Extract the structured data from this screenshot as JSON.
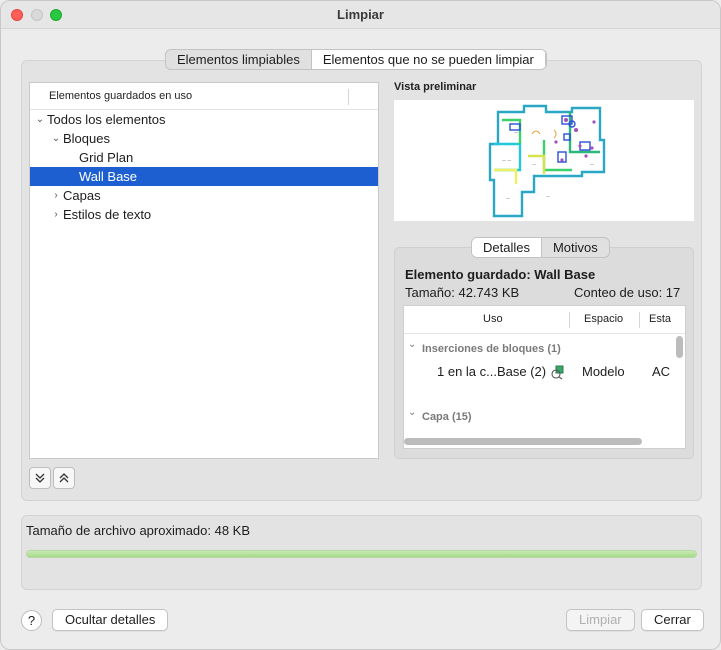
{
  "window": {
    "title": "Limpiar"
  },
  "tabs": {
    "purgeable": "Elementos limpiables",
    "non_purgeable": "Elementos que no se pueden limpiar"
  },
  "tree": {
    "header": "Elementos guardados en uso",
    "items": [
      {
        "label": "Todos los elementos",
        "level": 0,
        "expanded": true,
        "has_children": true
      },
      {
        "label": "Bloques",
        "level": 1,
        "expanded": true,
        "has_children": true
      },
      {
        "label": "Grid Plan",
        "level": 2,
        "has_children": false
      },
      {
        "label": "Wall Base",
        "level": 2,
        "has_children": false,
        "selected": true
      },
      {
        "label": "Capas",
        "level": 1,
        "expanded": false,
        "has_children": true
      },
      {
        "label": "Estilos de texto",
        "level": 1,
        "expanded": false,
        "has_children": true
      }
    ]
  },
  "preview": {
    "label": "Vista preliminar"
  },
  "details": {
    "tabs": {
      "details": "Detalles",
      "reasons": "Motivos"
    },
    "title": "Elemento guardado: Wall Base",
    "size": "Tamaño: 42.743 KB",
    "use_count": "Conteo de uso: 17",
    "table": {
      "columns": [
        "Uso",
        "Espacio",
        "Esta"
      ],
      "groups": [
        {
          "label": "Inserciones de bloques (1)",
          "rows": [
            {
              "use": "1 en la c...Base (2)",
              "space": "Modelo",
              "state": "AC"
            }
          ]
        },
        {
          "label": "Capa (15)",
          "rows": []
        }
      ]
    }
  },
  "file": {
    "approx_size": "Tamaño de archivo aproximado: 48 KB",
    "progress": 1.0
  },
  "buttons": {
    "help": "?",
    "hide_details": "Ocultar detalles",
    "purge": "Limpiar",
    "close": "Cerrar"
  },
  "colors": {
    "selection": "#1d5fd1",
    "progress": "#a6d98a"
  }
}
